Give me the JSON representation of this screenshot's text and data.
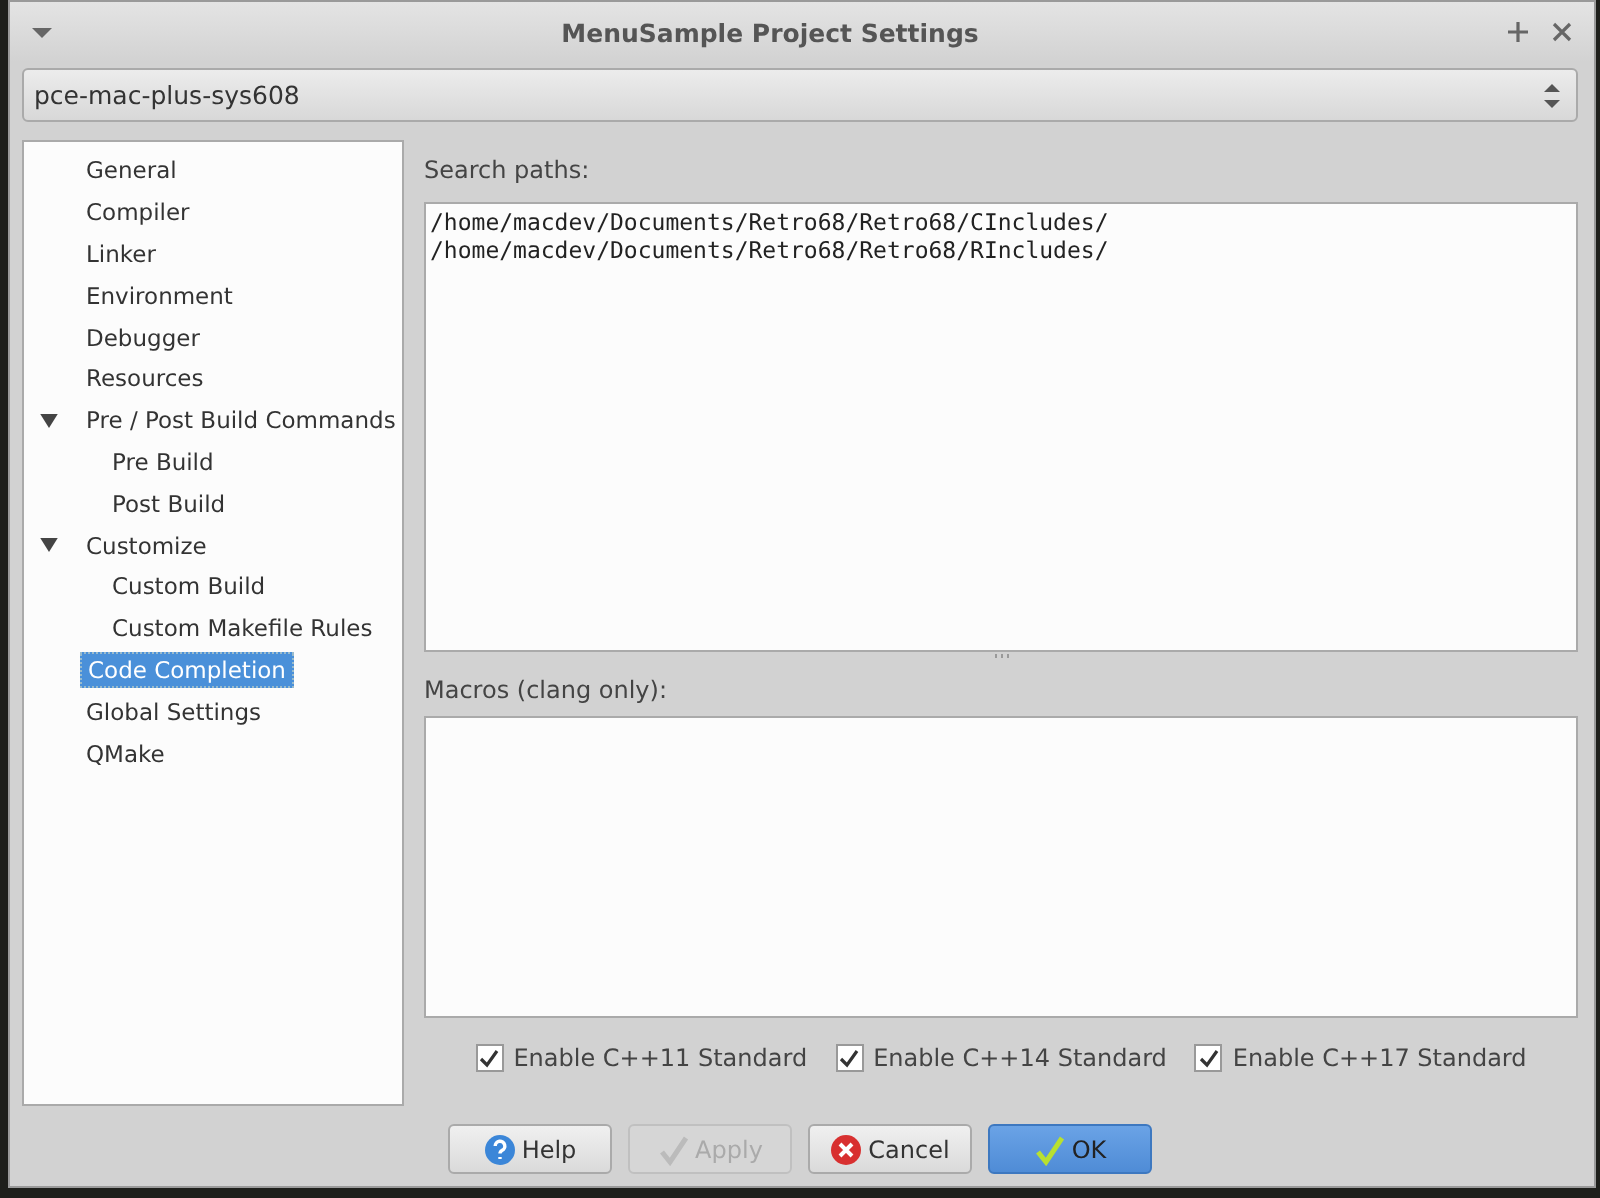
{
  "window": {
    "title": "MenuSample Project Settings"
  },
  "configuration": {
    "value": "pce-mac-plus-sys608"
  },
  "tree": [
    {
      "label": "General",
      "selected": false
    },
    {
      "label": "Compiler",
      "selected": false
    },
    {
      "label": "Linker",
      "selected": false
    },
    {
      "label": "Environment",
      "selected": false
    },
    {
      "label": "Debugger",
      "selected": false
    },
    {
      "label": "Resources",
      "selected": false
    },
    {
      "label": "Pre / Post Build Commands",
      "selected": false,
      "expanded": true,
      "children": [
        {
          "label": "Pre Build",
          "selected": false
        },
        {
          "label": "Post Build",
          "selected": false
        }
      ]
    },
    {
      "label": "Customize",
      "selected": false,
      "expanded": true,
      "children": [
        {
          "label": "Custom Build",
          "selected": false
        },
        {
          "label": "Custom Makefile Rules",
          "selected": false
        }
      ]
    },
    {
      "label": "Code Completion",
      "selected": true
    },
    {
      "label": "Global Settings",
      "selected": false
    },
    {
      "label": "QMake",
      "selected": false
    }
  ],
  "search_paths": {
    "label": "Search paths:",
    "lines": [
      "/home/macdev/Documents/Retro68/Retro68/CIncludes/",
      "/home/macdev/Documents/Retro68/Retro68/RIncludes/"
    ]
  },
  "macros": {
    "label": "Macros (clang only):"
  },
  "options": [
    {
      "label": "Enable C++11 Standard",
      "checked": true
    },
    {
      "label": "Enable C++14 Standard",
      "checked": true
    },
    {
      "label": "Enable C++17 Standard",
      "checked": true
    }
  ],
  "buttons": [
    {
      "label": "Help",
      "kind": "help",
      "disabled": false,
      "default": false
    },
    {
      "label": "Apply",
      "kind": "apply",
      "disabled": true,
      "default": false
    },
    {
      "label": "Cancel",
      "kind": "cancel",
      "disabled": false,
      "default": false
    },
    {
      "label": "OK",
      "kind": "ok",
      "disabled": false,
      "default": true
    }
  ]
}
